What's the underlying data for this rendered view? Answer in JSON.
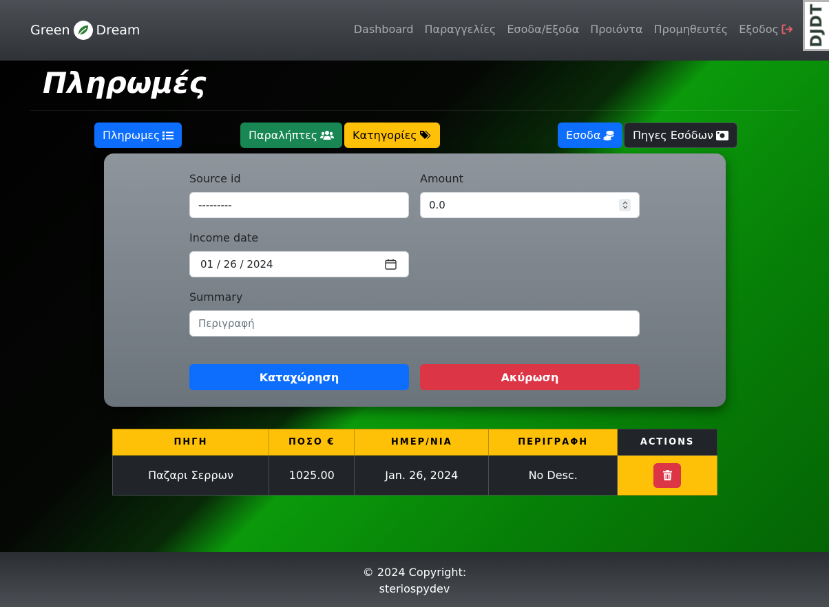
{
  "brand": {
    "left": "Green",
    "right": "Dream"
  },
  "nav": {
    "items": [
      "Dashboard",
      "Παραγγελίες",
      "Εσοδα/Εξοδα",
      "Προιόντα",
      "Προμηθευτές"
    ],
    "logout": "Εξοδος"
  },
  "djdt": "DJDT",
  "page": {
    "title": "Πληρωμές"
  },
  "toolbar": {
    "payments": "Πληρωμες",
    "payees": "Παραλήπτες",
    "categories": "Κατηγορίες",
    "income": "Εσοδα",
    "income_sources": "Πηγες Εσόδων"
  },
  "form": {
    "source_label": "Source id",
    "source_value": "---------",
    "amount_label": "Amount",
    "amount_value": "0.0",
    "date_label": "Income date",
    "date_value": "01 / 26 / 2024",
    "summary_label": "Summary",
    "summary_placeholder": "Περιγραφή",
    "submit": "Καταχώρηση",
    "cancel": "Ακύρωση"
  },
  "table": {
    "headers": [
      "ΠΗΓΗ",
      "ΠΟΣΟ €",
      "ΗΜΕΡ/ΝΙΑ",
      "ΠΕΡΙΓΡΑΦΗ",
      "ACTIONS"
    ],
    "rows": [
      {
        "source": "Παζαρι Σερρων",
        "amount": "1025.00",
        "date": "Jan. 26, 2024",
        "description": "No Desc."
      }
    ]
  },
  "footer": {
    "line1": "© 2024 Copyright:",
    "line2": "steriospydev"
  },
  "colors": {
    "primary": "#0d6efd",
    "success": "#198754",
    "warning": "#ffc107",
    "danger": "#dc3545",
    "dark": "#212529"
  },
  "icons": [
    "leaf-icon",
    "sign-out-icon",
    "list-icon",
    "users-icon",
    "tags-icon",
    "coins-icon",
    "money-bill-icon",
    "calendar-icon",
    "trash-icon"
  ]
}
